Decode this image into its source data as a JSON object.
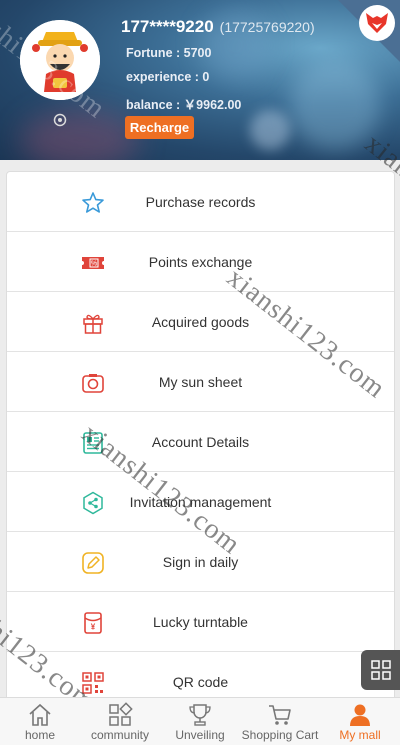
{
  "profile": {
    "username": "177****9220",
    "phone": "(17725769220)",
    "fortune": "Fortune : 5700",
    "experience": "experience : 0",
    "balance": "balance : ￥9962.00",
    "recharge_label": "Recharge"
  },
  "menu": [
    {
      "label": "Purchase records",
      "icon": "star-icon"
    },
    {
      "label": "Points exchange",
      "icon": "ticket-icon"
    },
    {
      "label": "Acquired goods",
      "icon": "gift-icon"
    },
    {
      "label": "My sun sheet",
      "icon": "camera-icon"
    },
    {
      "label": "Account Details",
      "icon": "document-icon"
    },
    {
      "label": "Invitation management",
      "icon": "share-icon"
    },
    {
      "label": "Sign in daily",
      "icon": "pencil-icon"
    },
    {
      "label": "Lucky turntable",
      "icon": "red-envelope-icon"
    },
    {
      "label": "QR code",
      "icon": "qr-code-icon"
    }
  ],
  "tabbar": [
    {
      "label": "home",
      "icon": "home-icon"
    },
    {
      "label": "community",
      "icon": "grid-icon"
    },
    {
      "label": "Unveiling",
      "icon": "trophy-icon"
    },
    {
      "label": "Shopping Cart",
      "icon": "cart-icon"
    },
    {
      "label": "My mall",
      "icon": "person-icon",
      "active": true
    }
  ],
  "watermark_text": "xianshi123.com",
  "colors": {
    "accent": "#ee6f23",
    "menu_icon_blue": "#3a9ad9",
    "menu_icon_red": "#e0443a",
    "menu_icon_green": "#2fb89b",
    "menu_icon_yellow": "#f0b324"
  }
}
